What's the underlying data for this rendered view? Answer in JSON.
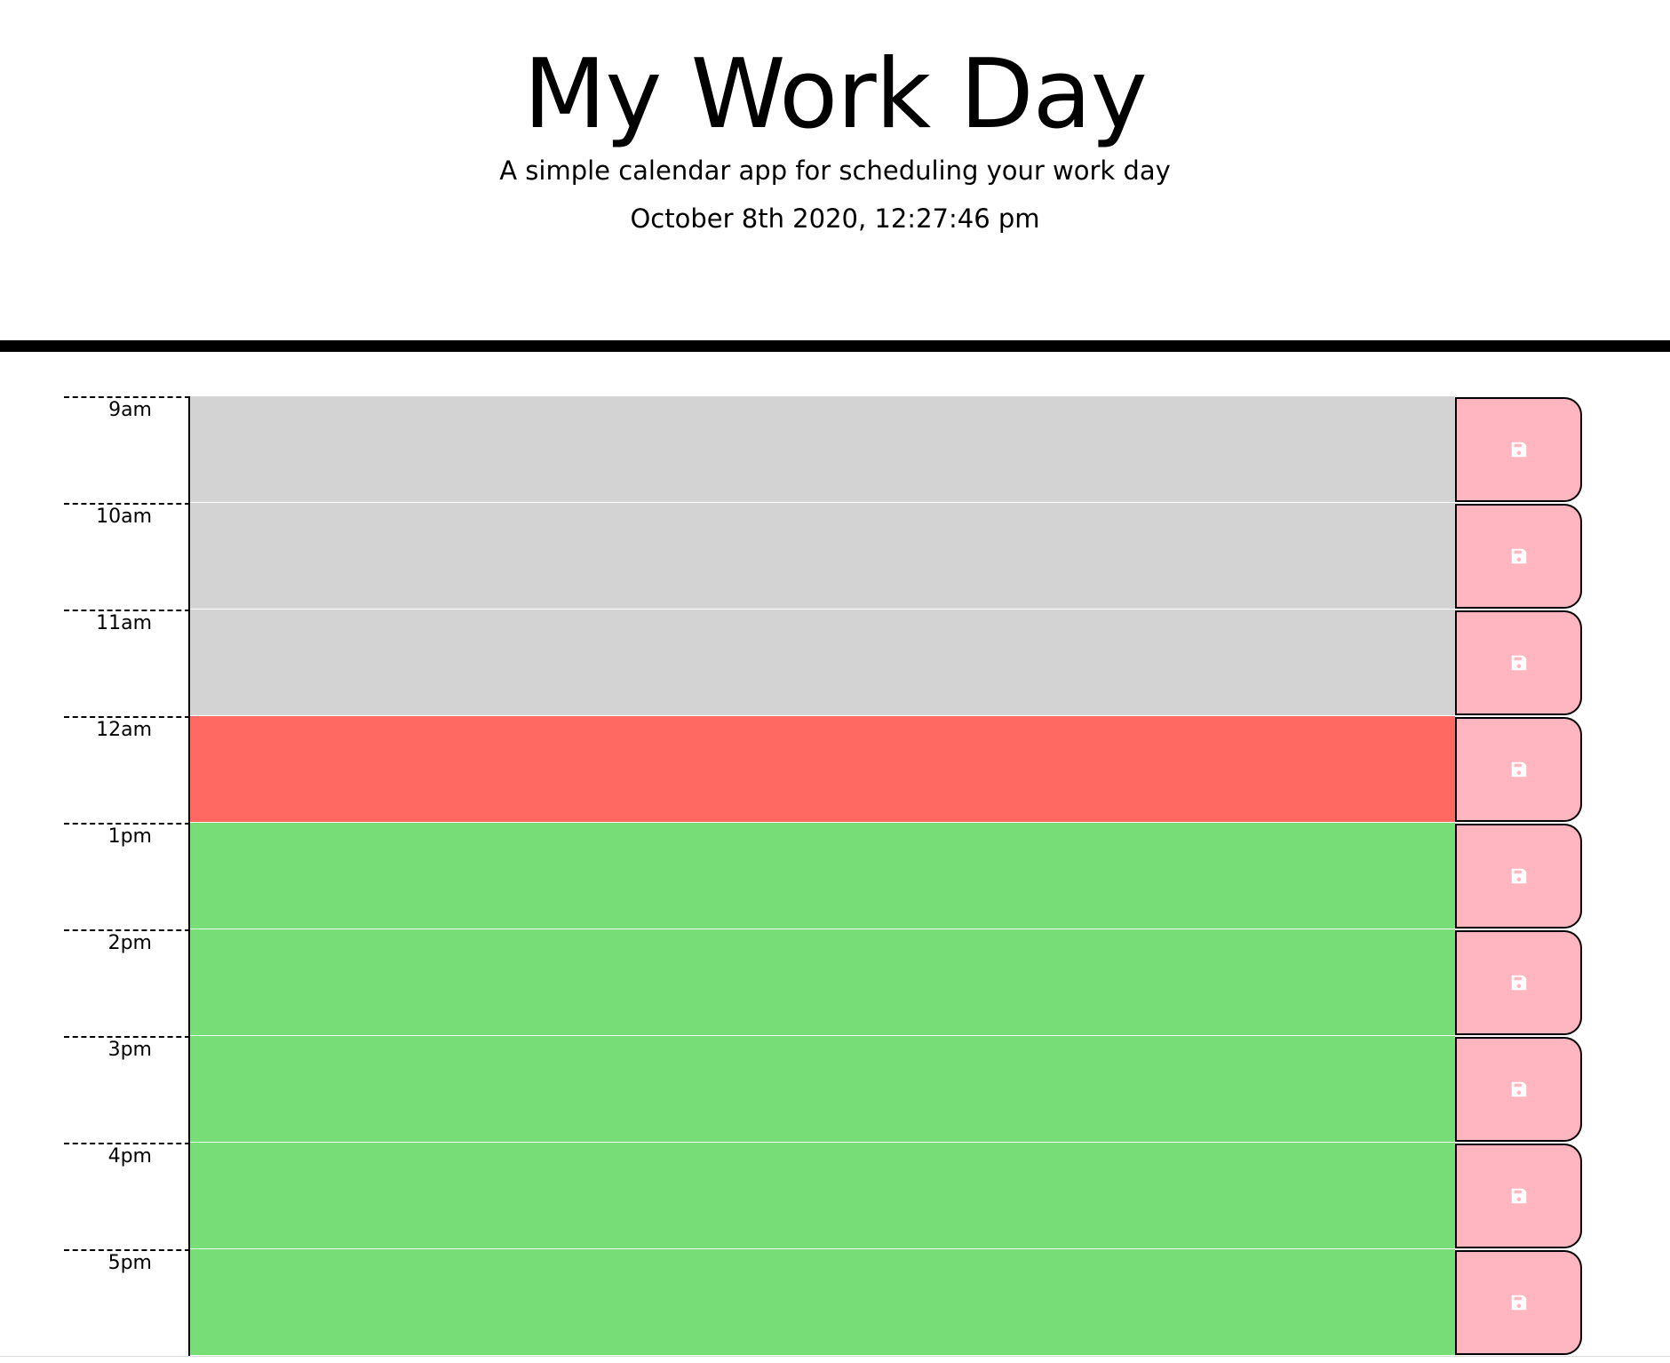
{
  "header": {
    "title": "My Work Day",
    "lead": "A simple calendar app for scheduling your work day",
    "current_day": "October 8th 2020, 12:27:46 pm"
  },
  "colors": {
    "past": "#d3d3d3",
    "present": "#ff6961",
    "future": "#77dd77",
    "save_button": "#ffb6c1",
    "save_icon": "#ffffff"
  },
  "save_button_icon": "floppy-disk-icon",
  "time_blocks": [
    {
      "hour": "9am",
      "status": "past",
      "text": ""
    },
    {
      "hour": "10am",
      "status": "past",
      "text": ""
    },
    {
      "hour": "11am",
      "status": "past",
      "text": ""
    },
    {
      "hour": "12am",
      "status": "present",
      "text": ""
    },
    {
      "hour": "1pm",
      "status": "future",
      "text": ""
    },
    {
      "hour": "2pm",
      "status": "future",
      "text": ""
    },
    {
      "hour": "3pm",
      "status": "future",
      "text": ""
    },
    {
      "hour": "4pm",
      "status": "future",
      "text": ""
    },
    {
      "hour": "5pm",
      "status": "future",
      "text": ""
    }
  ]
}
